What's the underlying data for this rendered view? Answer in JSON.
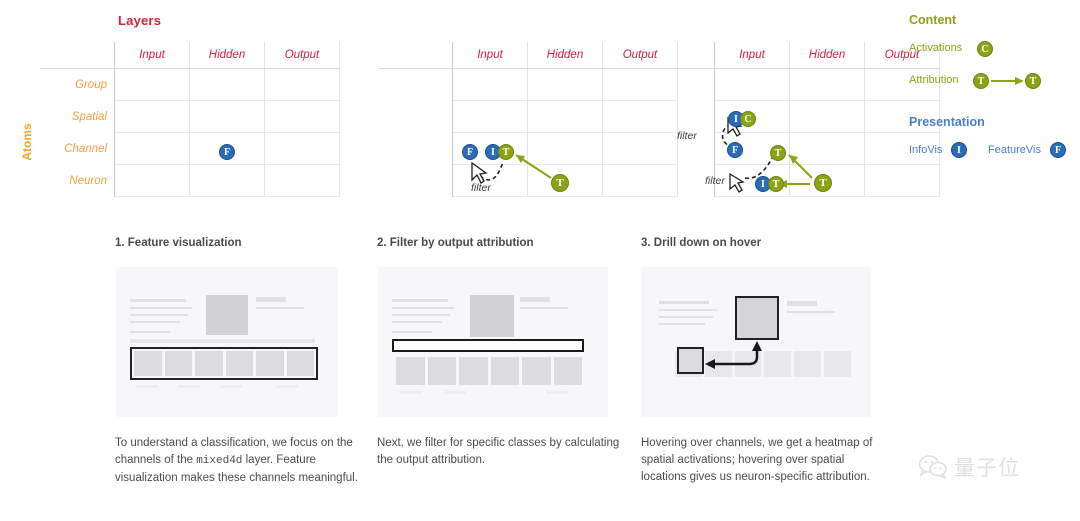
{
  "matrix": {
    "title": "Layers",
    "row_axis_label": "Atoms",
    "columns": [
      "Input",
      "Hidden",
      "Output"
    ],
    "rows": [
      "Group",
      "Spatial",
      "Channel",
      "Neuron"
    ],
    "filter_label": "filter",
    "badge_letters": {
      "featurevis": "F",
      "infovis": "I",
      "attribution": "T",
      "activations": "C"
    },
    "panels": [
      {
        "name": "panel-1-feature-visualization",
        "badges": [
          {
            "row": "Channel",
            "column": "Hidden",
            "letter": "F",
            "kind": "featurevis"
          }
        ],
        "filters": [],
        "arrows": []
      },
      {
        "name": "panel-2-filter-by-output-attribution",
        "badges": [
          {
            "row": "Channel",
            "column": "Hidden",
            "letter": "F",
            "kind": "featurevis"
          },
          {
            "row": "Channel",
            "column": "Hidden",
            "letter": "I",
            "kind": "infovis"
          },
          {
            "row": "Channel",
            "column": "Hidden",
            "letter": "T",
            "kind": "attribution"
          },
          {
            "row": "Neuron",
            "column": "Output",
            "letter": "T",
            "kind": "attribution"
          }
        ],
        "filters": [
          "filter"
        ],
        "arrows": [
          "output-attribution-to-hidden-channel"
        ]
      },
      {
        "name": "panel-3-drill-down-on-hover",
        "badges": [
          {
            "row": "Spatial",
            "column": "Hidden",
            "letter": "I",
            "kind": "infovis"
          },
          {
            "row": "Spatial",
            "column": "Hidden",
            "letter": "C",
            "kind": "activations"
          },
          {
            "row": "Channel",
            "column": "Hidden",
            "letter": "F",
            "kind": "featurevis"
          },
          {
            "row": "Channel",
            "column": "Output",
            "letter": "T",
            "kind": "attribution"
          },
          {
            "row": "Neuron",
            "column": "Hidden",
            "letter": "I",
            "kind": "infovis"
          },
          {
            "row": "Neuron",
            "column": "Hidden",
            "letter": "T",
            "kind": "attribution"
          },
          {
            "row": "Neuron",
            "column": "Output",
            "letter": "T",
            "kind": "attribution"
          }
        ],
        "filters": [
          "filter",
          "filter"
        ],
        "arrows": [
          "output-to-channel-attribution",
          "output-to-neuron-attribution"
        ]
      }
    ]
  },
  "legend": {
    "content": {
      "heading": "Content",
      "items": [
        {
          "label": "Activations",
          "badge": "C",
          "kind": "activations"
        },
        {
          "label": "Attribution",
          "badge": "T",
          "kind": "attribution",
          "has_arrow": true,
          "badge_2": "T"
        }
      ]
    },
    "presentation": {
      "heading": "Presentation",
      "items": [
        {
          "label": "InfoVis",
          "badge": "I",
          "kind": "infovis"
        },
        {
          "label": "FeatureVis",
          "badge": "F",
          "kind": "featurevis"
        }
      ]
    }
  },
  "steps": [
    {
      "title": "1. Feature visualization",
      "caption_before": "To understand a classification, we focus on the channels of the ",
      "caption_code": "mixed4d",
      "caption_after": " layer. Feature visualization makes these channels meaningful.",
      "highlight": "channel-thumbnail-row"
    },
    {
      "title": "2. Filter by output attribution",
      "caption_before": "Next, we filter for specific classes by calculating the output attribution.",
      "caption_code": "",
      "caption_after": "",
      "highlight": "class-filter-bar"
    },
    {
      "title": "3. Drill down on hover",
      "caption_before": "Hovering over channels, we get a heatmap of spatial activations; hovering over spatial locations gives us neuron-specific attribution.",
      "caption_code": "",
      "caption_after": "",
      "highlight": "hover-zoom-callout"
    }
  ],
  "watermark": {
    "text": "量子位",
    "icon": "wechat-icon"
  },
  "colors": {
    "layers_title": "#d6203c",
    "column_header": "#d6203c",
    "row_header": "#f0a13c",
    "atoms_label": "#f5a623",
    "content_heading": "#8ba314",
    "presentation_heading": "#4a7fc1",
    "badge_blue": "#2b6cb8",
    "badge_green": "#8ba314",
    "caption_text": "#4b4b4b"
  }
}
